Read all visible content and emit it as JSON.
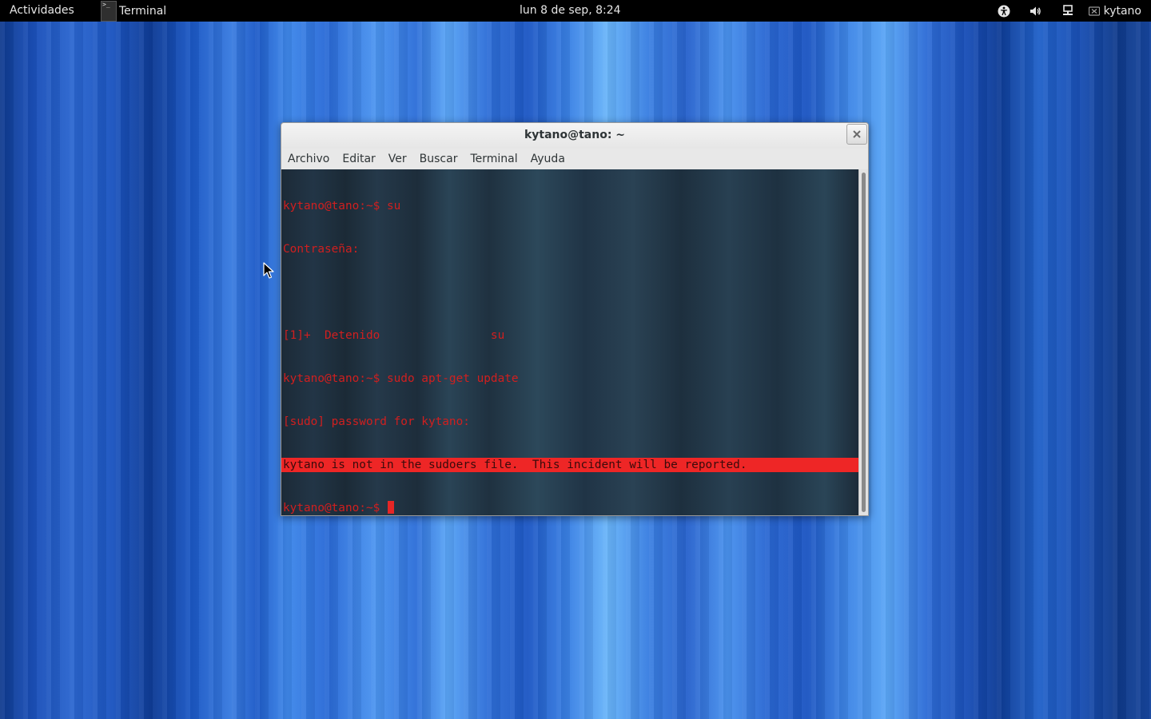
{
  "topbar": {
    "activities_label": "Actividades",
    "app_name": "Terminal",
    "clock": "lun  8 de sep,  8:24",
    "user_name": "kytano",
    "tray_icons": [
      "accessibility-icon",
      "volume-icon",
      "network-icon",
      "user-status-icon"
    ]
  },
  "window": {
    "title": "kytano@tano: ~",
    "close_icon": "close-icon"
  },
  "menubar": {
    "items": [
      "Archivo",
      "Editar",
      "Ver",
      "Buscar",
      "Terminal",
      "Ayuda"
    ]
  },
  "terminal": {
    "lines": [
      "kytano@tano:~$ su",
      "Contraseña:",
      "",
      "[1]+  Detenido                su",
      "kytano@tano:~$ sudo apt-get update",
      "[sudo] password for kytano:",
      "kytano is not in the sudoers file.  This incident will be reported.",
      "kytano@tano:~$ "
    ],
    "highlighted_line_index": 6,
    "text_color": "#d01f1f",
    "highlight_color": "#ee2626"
  },
  "colors": {
    "topbar_bg": "#000000",
    "window_bg": "#e8e8e8"
  }
}
